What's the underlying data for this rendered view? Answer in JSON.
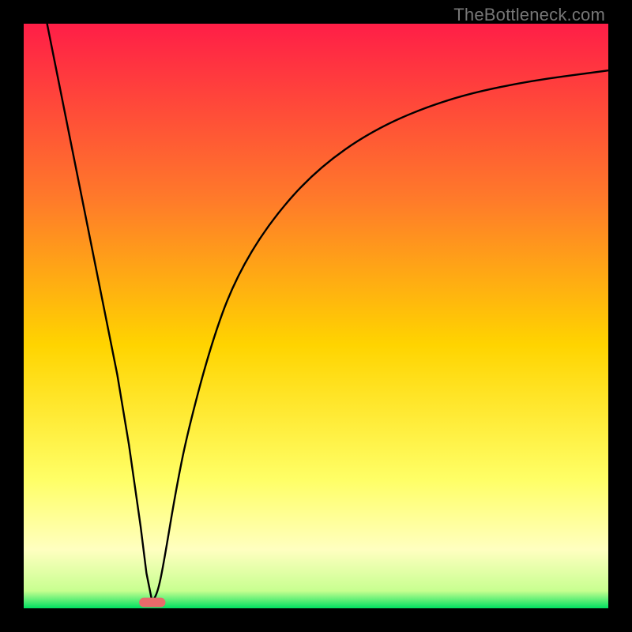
{
  "watermark": "TheBottleneck.com",
  "chart_data": {
    "type": "line",
    "title": "",
    "xlabel": "",
    "ylabel": "",
    "xlim": [
      0,
      100
    ],
    "ylim": [
      0,
      100
    ],
    "grid": false,
    "legend": false,
    "background_gradient": {
      "top": "#FF1E47",
      "mid_upper": "#FF7A2A",
      "mid": "#FFD400",
      "mid_lower": "#FFFF66",
      "lower_band": "#FFFFC0",
      "bottom": "#00E060"
    },
    "curve": {
      "description": "V-shaped bottleneck curve; steep linear descent to a minimum then asymptotic rise",
      "min_x": 22,
      "min_y": 1,
      "points": [
        {
          "x": 4,
          "y": 100
        },
        {
          "x": 6,
          "y": 90
        },
        {
          "x": 8,
          "y": 80
        },
        {
          "x": 10,
          "y": 70
        },
        {
          "x": 12,
          "y": 60
        },
        {
          "x": 14,
          "y": 50
        },
        {
          "x": 16,
          "y": 40
        },
        {
          "x": 18,
          "y": 28
        },
        {
          "x": 20,
          "y": 14
        },
        {
          "x": 21,
          "y": 6
        },
        {
          "x": 22,
          "y": 1
        },
        {
          "x": 23,
          "y": 3
        },
        {
          "x": 24,
          "y": 8
        },
        {
          "x": 26,
          "y": 20
        },
        {
          "x": 28,
          "y": 30
        },
        {
          "x": 32,
          "y": 45
        },
        {
          "x": 36,
          "y": 56
        },
        {
          "x": 42,
          "y": 66
        },
        {
          "x": 50,
          "y": 75
        },
        {
          "x": 60,
          "y": 82
        },
        {
          "x": 72,
          "y": 87
        },
        {
          "x": 85,
          "y": 90
        },
        {
          "x": 100,
          "y": 92
        }
      ]
    },
    "marker": {
      "shape": "rounded-pill",
      "x": 22,
      "y": 1,
      "color": "#E86A6A",
      "width_pct": 4.5,
      "height_pct": 1.6
    }
  }
}
